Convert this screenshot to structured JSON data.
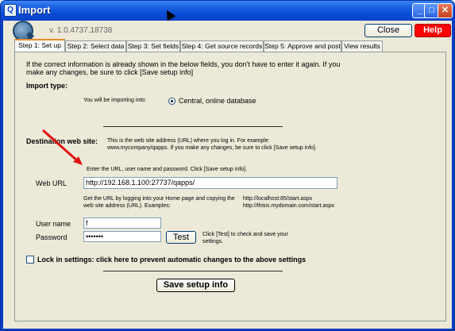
{
  "window": {
    "title": "Import",
    "icon_glyph": "Q",
    "min_glyph": "_",
    "max_glyph": "□",
    "close_glyph": "✕"
  },
  "header": {
    "version": "v. 1.0.4737.18738",
    "close_label": "Close",
    "help_label": "Help"
  },
  "tabs": [
    {
      "label": "Step 1: Set up",
      "active": true
    },
    {
      "label": "Step 2: Select data"
    },
    {
      "label": "Step 3: Set fields"
    },
    {
      "label": "Step 4: Get source records"
    },
    {
      "label": "Step 5: Approve and post"
    },
    {
      "label": "View results"
    }
  ],
  "setup": {
    "intro_line1": "If the correct information is already shown in the below fields, you don't have to enter it again. If you",
    "intro_line2": "make any changes, be sure to click [Save setup info]",
    "import_type_heading": "Import type:",
    "importing_into_label": "You will be importing into:",
    "importing_into_value": "Central, online database",
    "destination_heading": "Destination web site:",
    "destination_help_line1": "This is the web site address (URL) where you log in. For example:",
    "destination_help_line2": "www.mycompany/qapps. If you make any changes, be sure to click [Save setup info].",
    "enter_instructions": "Enter the URL, user name and password. Click [Save setup info].",
    "web_url_label": "Web URL",
    "web_url_value": "http://192.168.1.100:27737/qapps/",
    "url_help_line1": "Get the URL by logging into your Home page and copying the",
    "url_help_line2": "web site address (URL). Examples:",
    "example1": "http://localhost:85/start.aspx",
    "example2": "http://thisis.mydomain.com/start.aspx",
    "user_name_label": "User name",
    "user_name_value": "f",
    "password_label": "Password",
    "password_value": "•••••••",
    "test_label": "Test",
    "test_help_line1": "Click [Test] to check and save your",
    "test_help_line2": "settings.",
    "lock_label": "Lock in settings: click here to prevent automatic changes to the above settings",
    "save_label": "Save setup info"
  },
  "colors": {
    "title_bar": "#0a4cd6",
    "help_button": "#ff0000",
    "annotation_arrow": "#e01010"
  }
}
